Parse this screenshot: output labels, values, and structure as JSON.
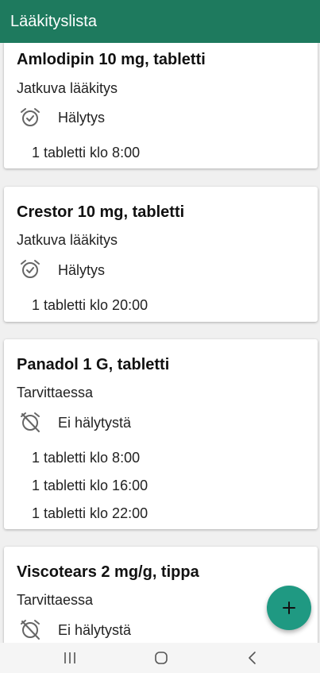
{
  "appbar": {
    "title": "Lääkityslista",
    "color": "#1e7a5e"
  },
  "medications": [
    {
      "name": "Amlodipin 10 mg, tabletti",
      "type": "Jatkuva lääkitys",
      "alarm_icon": "alarm-on-icon",
      "alarm_label": "Hälytys",
      "doses": [
        "1 tabletti klo 8:00"
      ]
    },
    {
      "name": "Crestor 10 mg, tabletti",
      "type": "Jatkuva lääkitys",
      "alarm_icon": "alarm-on-icon",
      "alarm_label": "Hälytys",
      "doses": [
        "1 tabletti klo 20:00"
      ]
    },
    {
      "name": "Panadol 1 G, tabletti",
      "type": "Tarvittaessa",
      "alarm_icon": "alarm-off-icon",
      "alarm_label": "Ei hälytystä",
      "doses": [
        "1 tabletti klo 8:00",
        "1 tabletti klo 16:00",
        "1 tabletti klo 22:00"
      ]
    },
    {
      "name": "Viscotears 2 mg/g, tippa",
      "type": "Tarvittaessa",
      "alarm_icon": "alarm-off-icon",
      "alarm_label": "Ei hälytystä",
      "doses": []
    }
  ],
  "fab": {
    "icon": "plus-icon",
    "color": "#1f9982"
  },
  "navbar": {
    "buttons": [
      "recent-apps-icon",
      "home-icon",
      "back-icon"
    ]
  }
}
